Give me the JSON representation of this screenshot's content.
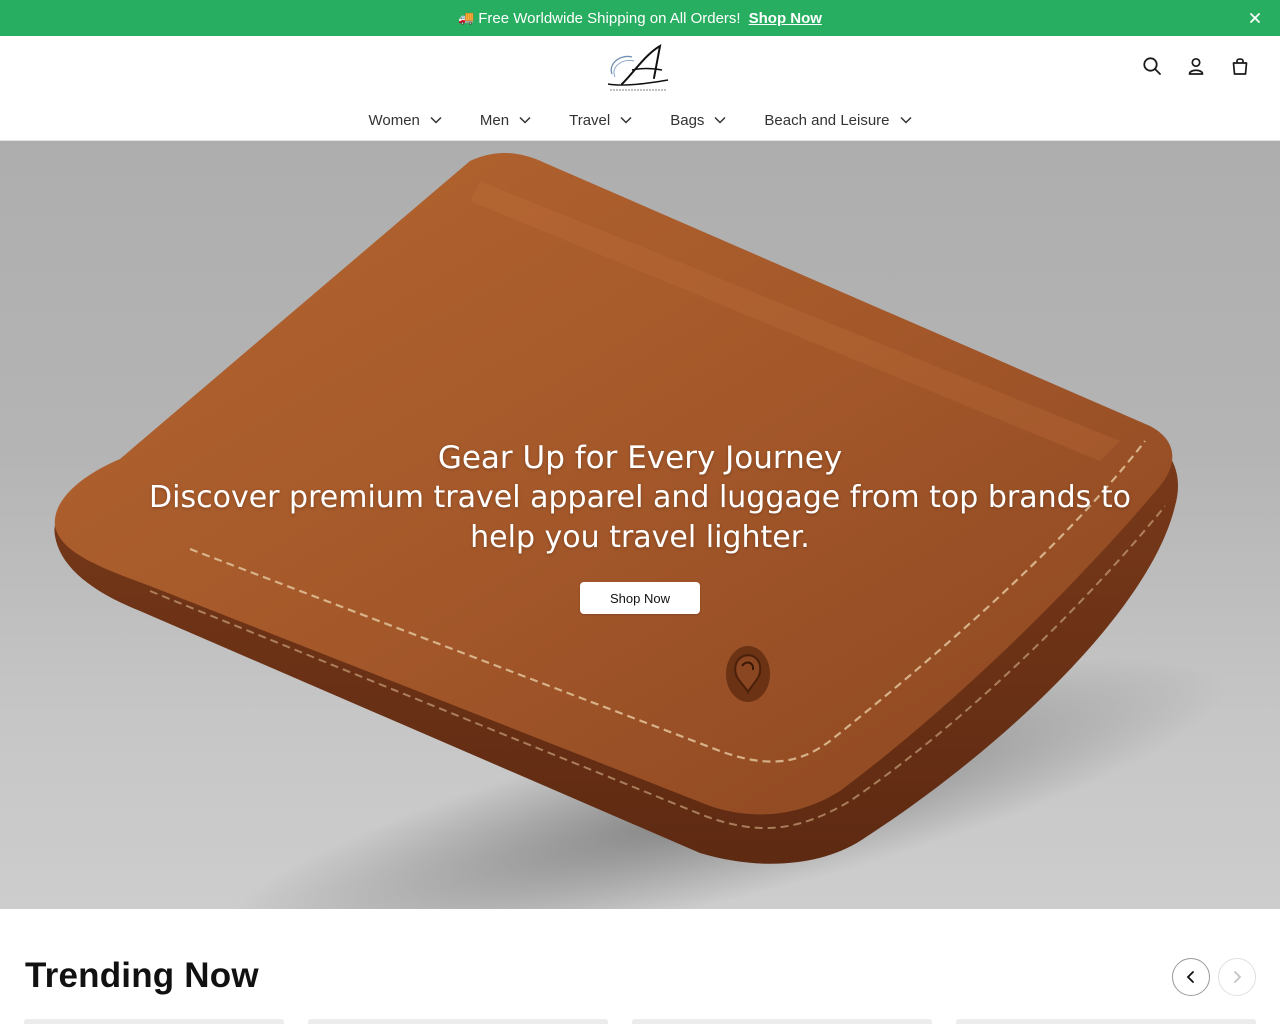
{
  "announcement": {
    "truck_icon": "truck-icon",
    "text": "Free Worldwide Shipping on All Orders!",
    "link": "Shop Now",
    "close_icon": "close-icon"
  },
  "header": {
    "logo": {
      "letter": "A",
      "tagline": "Adventure Clothing"
    },
    "icons": [
      "search-icon",
      "account-icon",
      "bag-icon"
    ]
  },
  "nav": {
    "items": [
      {
        "label": "Women"
      },
      {
        "label": "Men"
      },
      {
        "label": "Travel"
      },
      {
        "label": "Bags"
      },
      {
        "label": "Beach and Leisure"
      }
    ]
  },
  "hero": {
    "title": "Gear Up for Every Journey",
    "subtitle": "Discover premium travel apparel and luggage from top brands to help you travel lighter.",
    "button": "Shop Now"
  },
  "trending": {
    "title": "Trending Now",
    "prev_icon": "chevron-left-icon",
    "next_icon": "chevron-right-icon"
  },
  "colors": {
    "announcement_bg": "#27ae60",
    "wallet_leather": "#a4582a",
    "hero_bg": "#b0b0b0"
  }
}
